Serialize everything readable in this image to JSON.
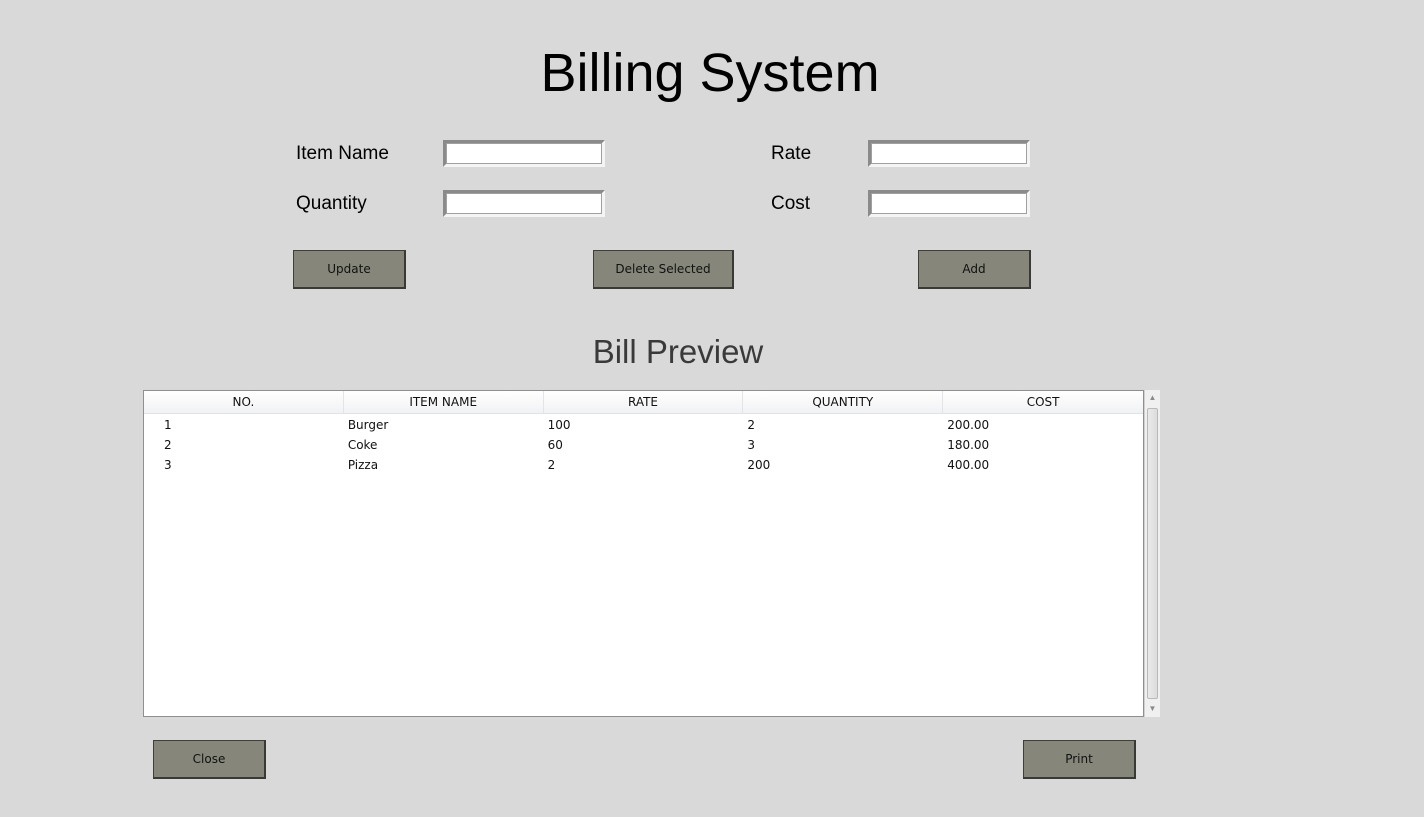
{
  "window": {
    "title": "Billing System"
  },
  "form": {
    "item_name_label": "Item Name",
    "item_name_value": "",
    "rate_label": "Rate",
    "rate_value": "",
    "quantity_label": "Quantity",
    "quantity_value": "",
    "cost_label": "Cost",
    "cost_value": ""
  },
  "actions": {
    "update_label": "Update",
    "delete_label": "Delete Selected",
    "add_label": "Add"
  },
  "preview": {
    "title": "Bill Preview",
    "columns": [
      "NO.",
      "ITEM NAME",
      "RATE",
      "QUANTITY",
      "COST"
    ],
    "rows": [
      [
        "1",
        "Burger",
        "100",
        "2",
        "200.00"
      ],
      [
        "2",
        "Coke",
        "60",
        "3",
        "180.00"
      ],
      [
        "3",
        "Pizza",
        "2",
        "200",
        "400.00"
      ]
    ]
  },
  "footer": {
    "close_label": "Close",
    "print_label": "Print"
  },
  "colors": {
    "background": "#d9d9d9",
    "button": "#86877a",
    "table_background": "#ffffff"
  },
  "icons": {
    "scroll_up": "up-arrow-icon",
    "scroll_down": "down-arrow-icon"
  }
}
